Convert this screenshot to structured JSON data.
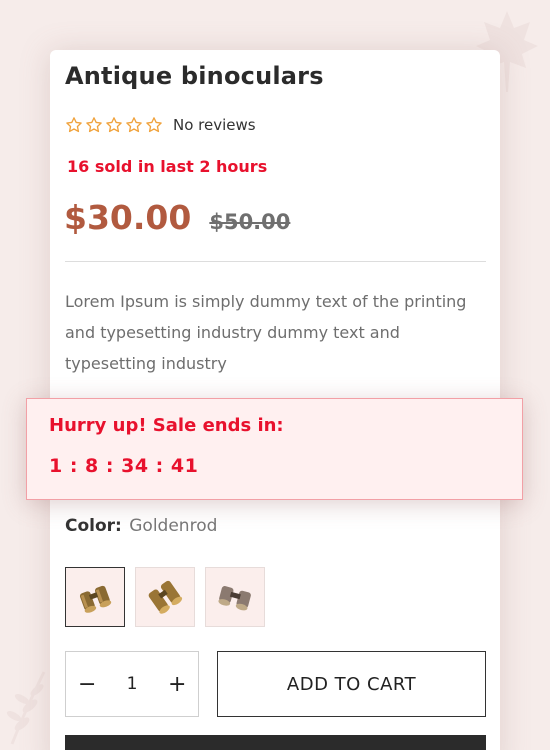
{
  "product": {
    "title": "Antique binoculars",
    "rating": {
      "stars": 5,
      "filled": 0,
      "reviews_text": "No reviews"
    },
    "sold_text": "16 sold in last 2 hours",
    "price": "$30.00",
    "compare_price": "$50.00",
    "description": "Lorem Ipsum is simply dummy text of the printing and typesetting industry dummy text and typesetting industry"
  },
  "urgency": {
    "title": "Hurry up! Sale ends in:",
    "countdown": "1 : 8 : 34 : 41"
  },
  "variant": {
    "label": "Color:",
    "value": "Goldenrod",
    "swatches": [
      "binoculars-goldenrod",
      "binoculars-brass",
      "binoculars-silver"
    ]
  },
  "cart": {
    "minus": "−",
    "plus": "+",
    "quantity": "1",
    "add_label": "ADD TO CART"
  },
  "colors": {
    "accent_red": "#e8112d",
    "price": "#b15a3f",
    "star": "#f0a23c",
    "background": "#f6ecea"
  }
}
